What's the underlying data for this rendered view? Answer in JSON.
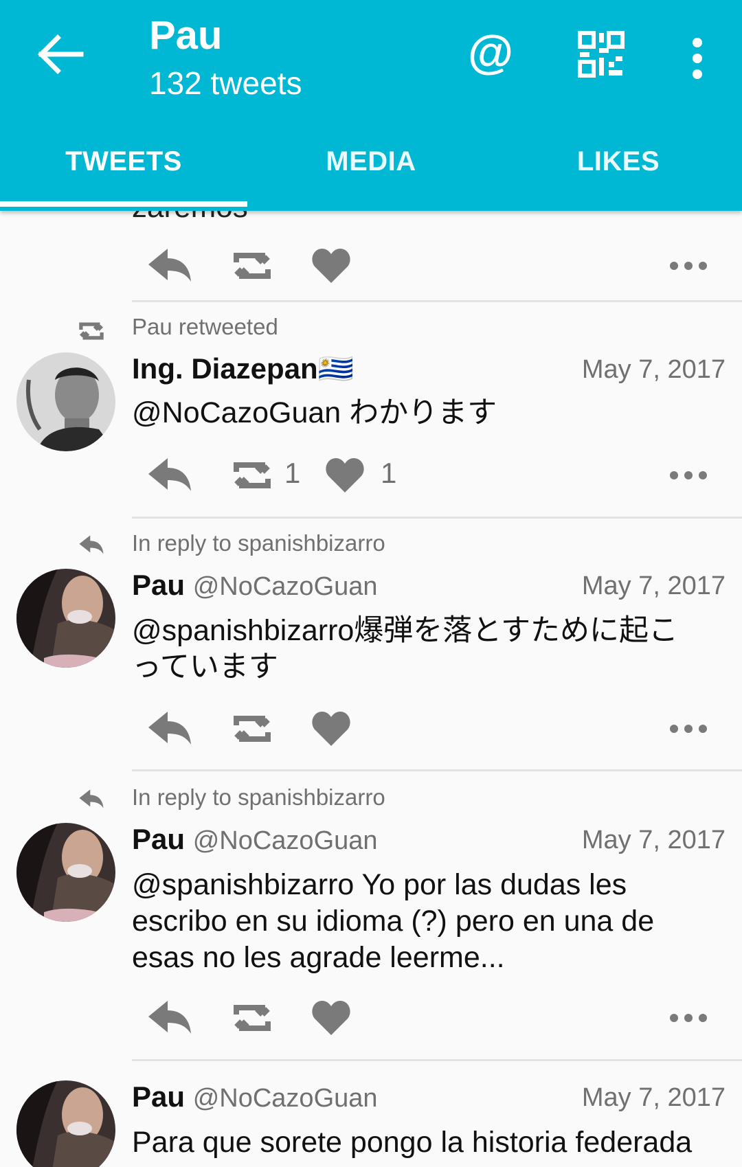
{
  "header": {
    "title": "Pau",
    "subtitle": "132 tweets",
    "at_symbol": "@",
    "icons": [
      "back-arrow-icon",
      "at-icon",
      "qr-code-icon",
      "more-vert-icon"
    ],
    "accent_color": "#00b7d4"
  },
  "tabs": [
    {
      "label": "TWEETS",
      "active": true
    },
    {
      "label": "MEDIA",
      "active": false
    },
    {
      "label": "LIKES",
      "active": false
    }
  ],
  "feed": {
    "partial_text": "zaremos",
    "tweets": [
      {
        "context": "Pau retweeted",
        "context_icon": "retweet-icon",
        "name": "Ing. Diazepan🇺🇾",
        "handle": "",
        "date": "May 7, 2017",
        "text": "@NoCazoGuan わかります",
        "retweet_count": "1",
        "like_count": "1"
      },
      {
        "context": "In reply to spanishbizarro",
        "context_icon": "reply-icon",
        "name": "Pau",
        "handle": "@NoCazoGuan",
        "date": "May 7, 2017",
        "text": "@spanishbizarro爆弾を落とすために起こっています",
        "retweet_count": "",
        "like_count": ""
      },
      {
        "context": "In reply to spanishbizarro",
        "context_icon": "reply-icon",
        "name": "Pau",
        "handle": "@NoCazoGuan",
        "date": "May 7, 2017",
        "text": "@spanishbizarro Yo por las dudas les escribo en su idioma (?) pero en una de esas no les agrade leerme...",
        "retweet_count": "",
        "like_count": ""
      },
      {
        "context": "",
        "context_icon": "",
        "name": "Pau",
        "handle": "@NoCazoGuan",
        "date": "May 7, 2017",
        "text": "Para que sorete pongo la historia federada",
        "retweet_count": "",
        "like_count": ""
      }
    ]
  }
}
